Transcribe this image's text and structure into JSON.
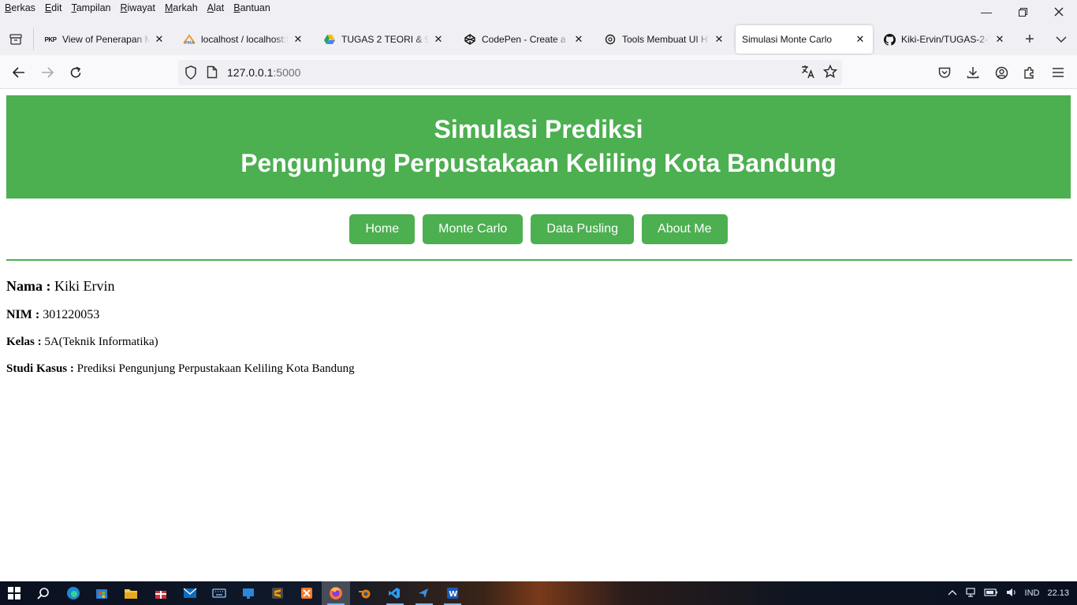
{
  "menubar": {
    "items": [
      {
        "ul": "B",
        "rest": "erkas"
      },
      {
        "ul": "E",
        "rest": "dit"
      },
      {
        "ul": "T",
        "rest": "ampilan"
      },
      {
        "ul": "R",
        "rest": "iwayat"
      },
      {
        "ul": "M",
        "rest": "arkah"
      },
      {
        "ul": "A",
        "rest": "lat"
      },
      {
        "ul": "B",
        "rest": "antuan"
      }
    ]
  },
  "tabs": [
    {
      "favicon": "PKP",
      "title": "View of Penerapan Me",
      "active": false
    },
    {
      "favicon": "phpmyadmin-icon",
      "title": "localhost / localhost:81",
      "active": false
    },
    {
      "favicon": "google-drive-icon",
      "title": "TUGAS 2 TEORI & 9 PR",
      "active": false
    },
    {
      "favicon": "codepen-icon",
      "title": "CodePen - Create a Ne",
      "active": false
    },
    {
      "favicon": "openai-icon",
      "title": "Tools Membuat UI HTM",
      "active": false
    },
    {
      "favicon": "",
      "title": "Simulasi Monte Carlo",
      "active": true
    },
    {
      "favicon": "github-icon",
      "title": "Kiki-Ervin/TUGAS-2-TE",
      "active": false
    }
  ],
  "urlbar": {
    "host": "127.0.0.1",
    "port": ":5000"
  },
  "page": {
    "title_line1": "Simulasi Prediksi",
    "title_line2": "Pengunjung Perpustakaan Keliling Kota Bandung",
    "nav": [
      "Home",
      "Monte Carlo",
      "Data Pusling",
      "About Me"
    ],
    "info": {
      "nama_label": "Nama :",
      "nama_value": " Kiki Ervin",
      "nim_label": "NIM :",
      "nim_value": " 301220053",
      "kelas_label": "Kelas :",
      "kelas_value": " 5A(Teknik Informatika)",
      "studi_label": "Studi Kasus :",
      "studi_value": " Prediksi Pengunjung Perpustakaan Keliling Kota Bandung"
    }
  },
  "taskbar": {
    "tray_lang": "IND",
    "clock": "22.13"
  },
  "colors": {
    "accent": "#4caf50"
  }
}
